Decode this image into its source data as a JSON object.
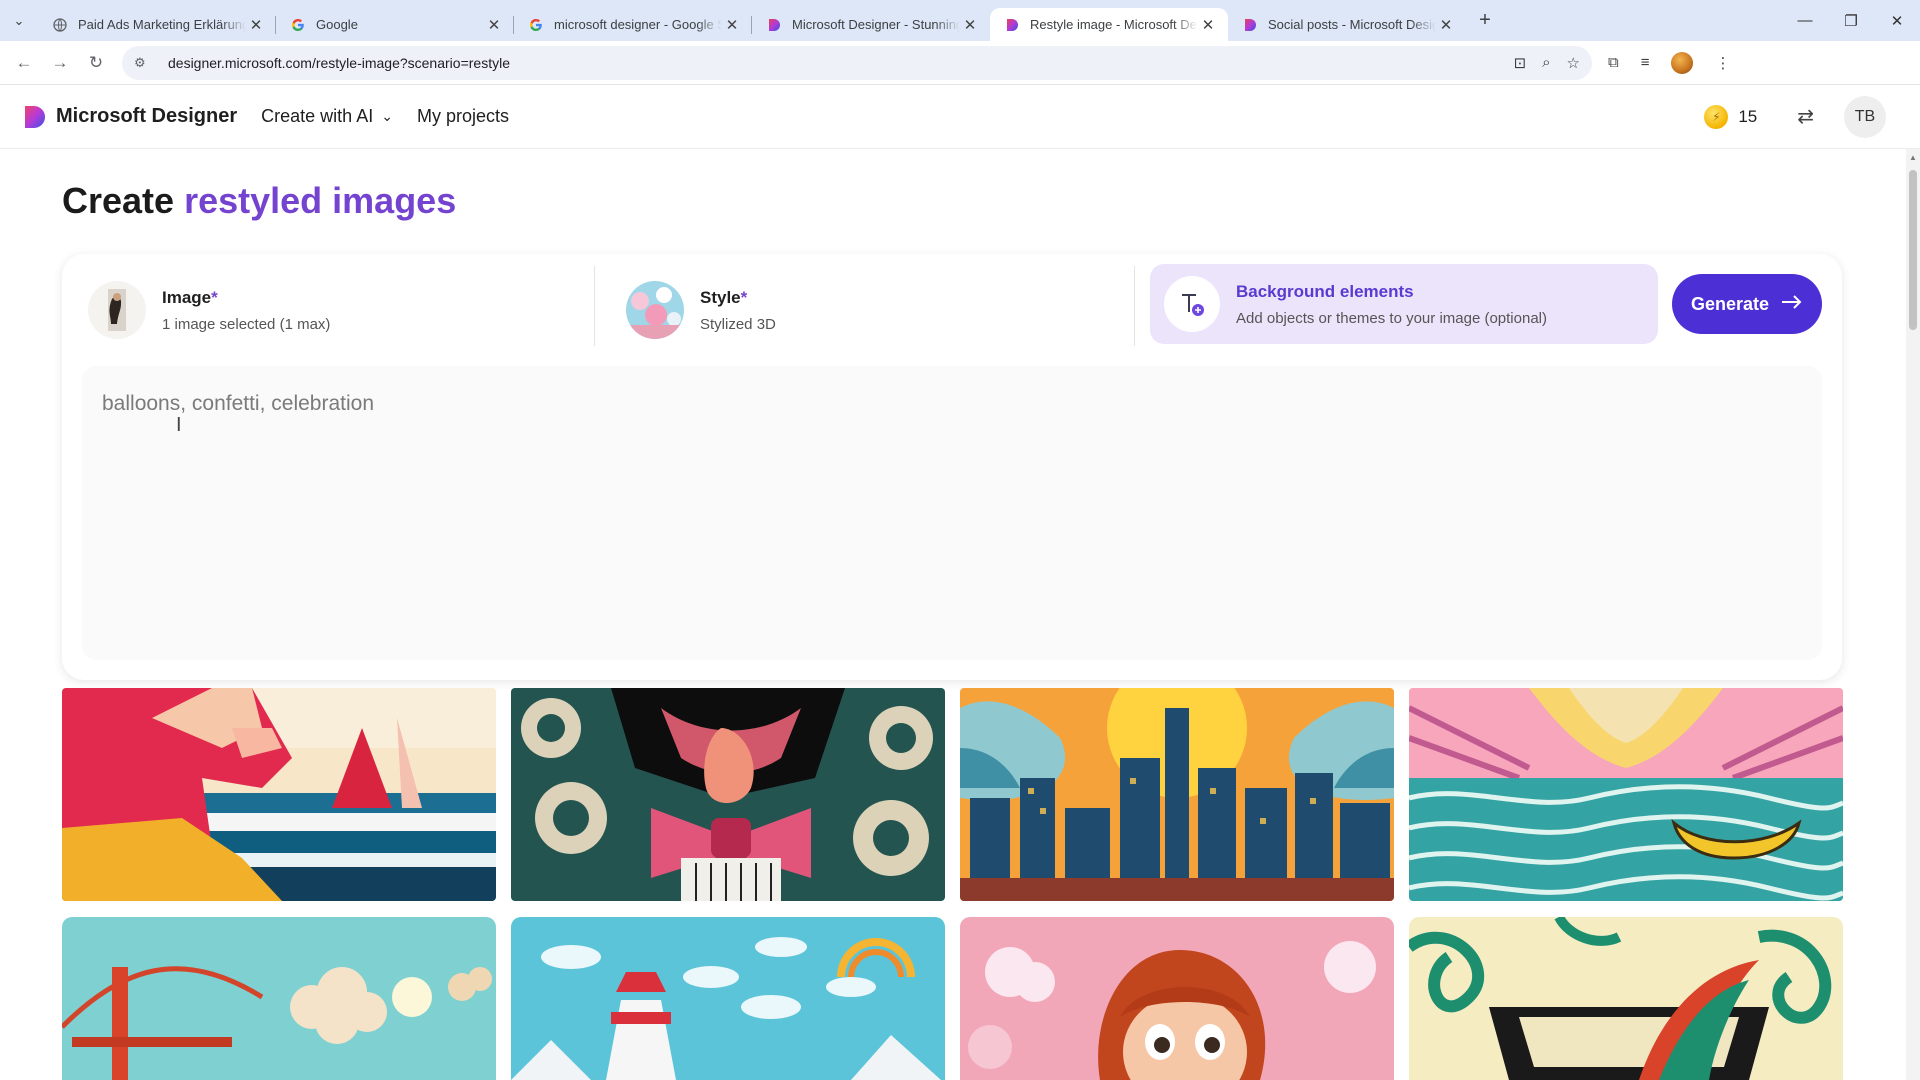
{
  "browser": {
    "tabs": [
      {
        "title": "Paid Ads Marketing Erklärung",
        "icon": "globe-icon"
      },
      {
        "title": "Google",
        "icon": "google-icon"
      },
      {
        "title": "microsoft designer - Google Se",
        "icon": "google-icon"
      },
      {
        "title": "Microsoft Designer - Stunning",
        "icon": "designer-icon"
      },
      {
        "title": "Restyle image - Microsoft Desig",
        "icon": "designer-icon",
        "active": true
      },
      {
        "title": "Social posts - Microsoft Design",
        "icon": "designer-icon"
      }
    ],
    "url": "designer.microsoft.com/restyle-image?scenario=restyle"
  },
  "header": {
    "brand": "Microsoft Designer",
    "create_with_ai": "Create with AI",
    "my_projects": "My projects",
    "coins": "15",
    "avatar_initials": "TB"
  },
  "main": {
    "title_prefix": "Create",
    "title_highlight": "restyled images",
    "image_option": {
      "label": "Image",
      "required": "*",
      "sub": "1 image selected (1 max)"
    },
    "style_option": {
      "label": "Style",
      "required": "*",
      "sub": "Stylized 3D"
    },
    "background_option": {
      "label": "Background elements",
      "sub": "Add objects or themes to your image (optional)"
    },
    "generate_label": "Generate",
    "prompt_placeholder": "balloons, confetti, celebration"
  },
  "colors": {
    "accent": "#7443cf",
    "generate_bg": "#4d2fd6",
    "bg_element_fill": "#ece4fb"
  },
  "gallery": {
    "row1": [
      "beach-portrait-tile",
      "bowtie-pop-art-tile",
      "pop-city-skyline-tile",
      "boat-waves-tile"
    ],
    "row2": [
      "golden-gate-clouds-tile",
      "paper-lighthouse-tile",
      "redhead-3d-character-tile",
      "swirl-graffiti-tile"
    ]
  }
}
